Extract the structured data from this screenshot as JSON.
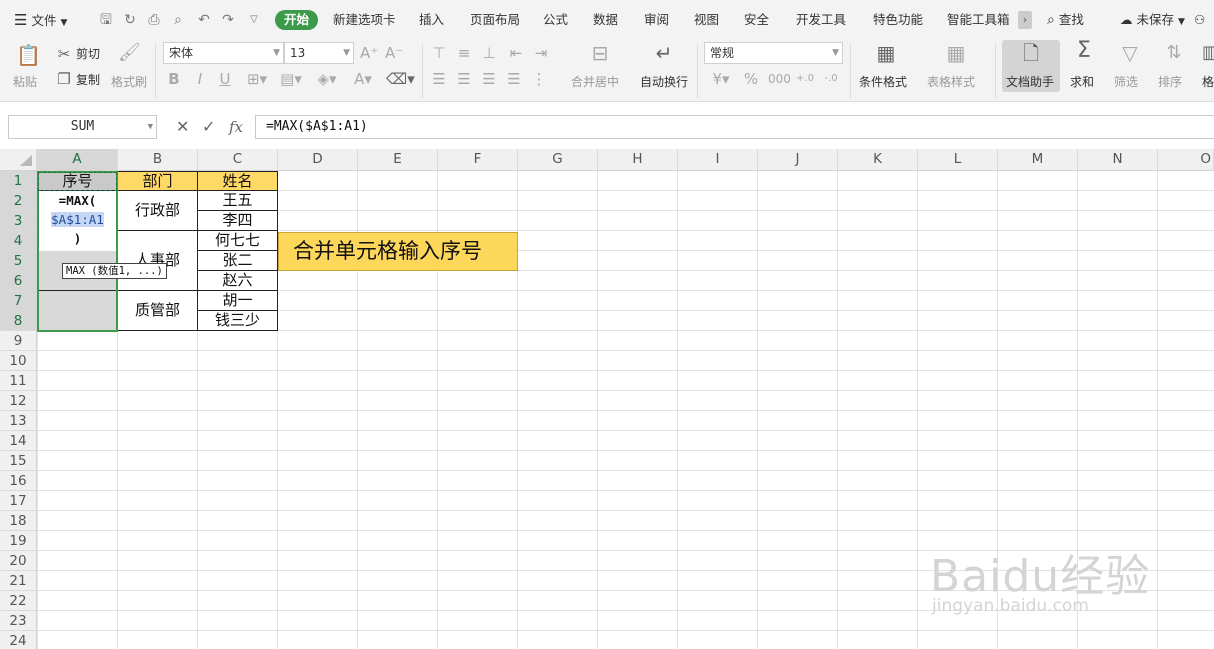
{
  "menubar": {
    "file_menu": "文件",
    "tabs": [
      "开始",
      "新建选项卡",
      "插入",
      "页面布局",
      "公式",
      "数据",
      "审阅",
      "视图",
      "安全",
      "开发工具",
      "特色功能",
      "智能工具箱"
    ],
    "search": "查找",
    "save_status": "未保存"
  },
  "ribbon": {
    "paste": "粘贴",
    "cut": "剪切",
    "copy": "复制",
    "format_painter": "格式刷",
    "font_name": "宋体",
    "font_size": "13",
    "number_format": "常规",
    "merge_center": "合并居中",
    "wrap_text": "自动换行",
    "conditional_format": "条件格式",
    "table_style": "表格样式",
    "doc_assistant": "文档助手",
    "sum": "求和",
    "filter": "筛选",
    "sort": "排序",
    "format_cut": "格"
  },
  "formula_bar": {
    "name_box": "SUM",
    "formula": "=MAX($A$1:A1)",
    "fx": "fx"
  },
  "grid": {
    "columns": [
      "A",
      "B",
      "C",
      "D",
      "E",
      "F",
      "G",
      "H",
      "I",
      "J",
      "K",
      "L",
      "M",
      "N",
      "O"
    ],
    "rows": [
      "1",
      "2",
      "3",
      "4",
      "5",
      "6",
      "7",
      "8",
      "9",
      "10",
      "11",
      "12",
      "13",
      "14",
      "15",
      "16",
      "17",
      "18",
      "19",
      "20",
      "21",
      "22",
      "23",
      "24"
    ],
    "header_seq": "序号",
    "header_dept": "部门",
    "header_name": "姓名",
    "depts": [
      "行政部",
      "人事部",
      "质管部"
    ],
    "names": [
      "王五",
      "李四",
      "何七七",
      "张二",
      "赵六",
      "胡一",
      "钱三少"
    ],
    "edit_line1": "=MAX(",
    "edit_line2": "$A$1:A1",
    "edit_line3": ")",
    "tooltip": "MAX (数值1, ...)",
    "callout": "合并单元格输入序号"
  },
  "watermark": {
    "brand": "Baidu经验",
    "url": "jingyan.baidu.com"
  }
}
